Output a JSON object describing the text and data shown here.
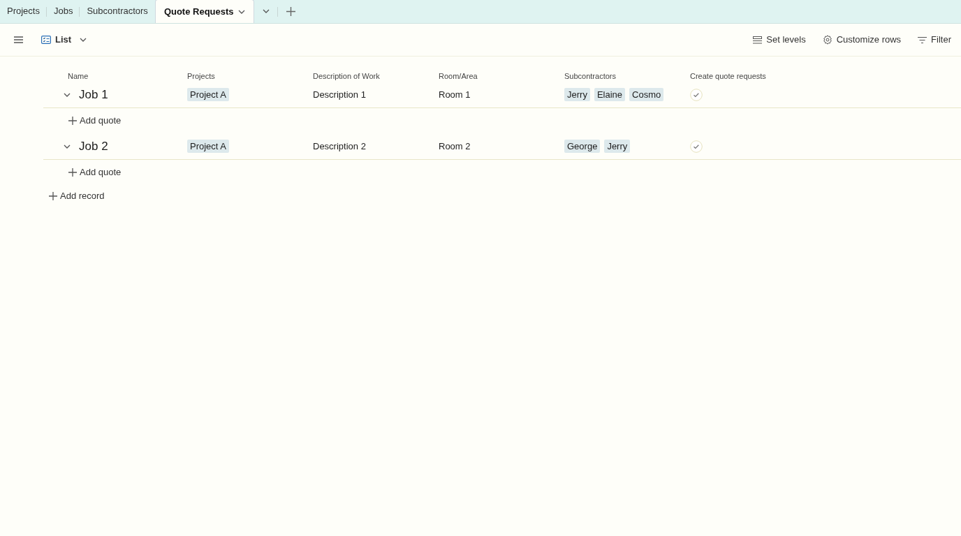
{
  "tabs": [
    {
      "label": "Projects",
      "selected": false
    },
    {
      "label": "Jobs",
      "selected": false
    },
    {
      "label": "Subcontractors",
      "selected": false
    },
    {
      "label": "Quote Requests",
      "selected": true
    }
  ],
  "toolbar": {
    "view": "List",
    "actions": [
      {
        "kind": "levels",
        "label": "Set levels"
      },
      {
        "kind": "gear",
        "label": "Customize rows"
      },
      {
        "kind": "filter",
        "label": "Filter"
      }
    ]
  },
  "table": {
    "columns": [
      "Name",
      "Projects",
      "Description of Work",
      "Room/Area",
      "Subcontractors",
      "Create quote requests"
    ],
    "rows": [
      {
        "name": "Job 1",
        "expanded": true,
        "projects": [
          "Project A"
        ],
        "description": "Description 1",
        "room": "Room 1",
        "subcontractors": [
          "Jerry",
          "Elaine",
          "Cosmo"
        ],
        "add_child": "Add quote"
      },
      {
        "name": "Job 2",
        "expanded": true,
        "projects": [
          "Project A"
        ],
        "description": "Description 2",
        "room": "Room 2",
        "subcontractors": [
          "George",
          "Jerry"
        ],
        "add_child": "Add quote"
      }
    ],
    "add_record": "Add record"
  }
}
